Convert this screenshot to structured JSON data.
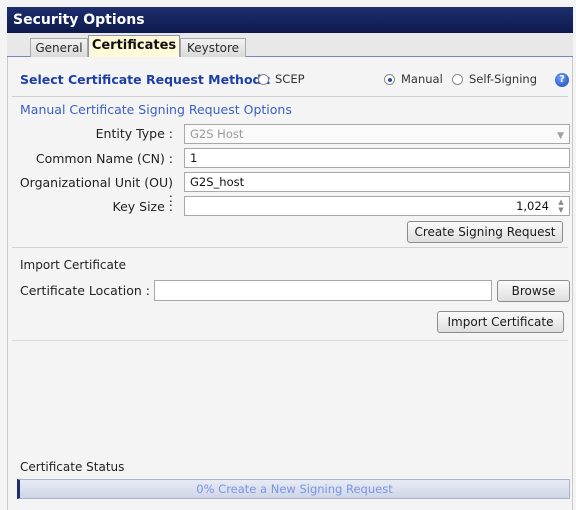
{
  "window": {
    "title": "Security Options"
  },
  "tabs": [
    {
      "label": "General",
      "active": false
    },
    {
      "label": "Certificates",
      "active": true
    },
    {
      "label": "Keystore",
      "active": false
    }
  ],
  "method": {
    "label": "Select Certificate Request Method :",
    "options": [
      {
        "label": "SCEP",
        "selected": false
      },
      {
        "label": "Manual",
        "selected": true
      },
      {
        "label": "Self-Signing",
        "selected": false
      }
    ]
  },
  "manual_csr": {
    "section_title": "Manual Certificate Signing Request Options",
    "entity_type": {
      "label": "Entity Type :",
      "value": "G2S Host"
    },
    "common_name": {
      "label": "Common Name (CN) :",
      "value": "1"
    },
    "org_unit": {
      "label": "Organizational Unit (OU) :",
      "value": "G2S_host"
    },
    "key_size": {
      "label": "Key Size :",
      "value": "1,024"
    },
    "create_button": "Create Signing Request"
  },
  "import": {
    "section_title": "Import Certificate",
    "location_label": "Certificate Location :",
    "location_value": "",
    "browse_button": "Browse",
    "import_button": "Import Certificate"
  },
  "status": {
    "title": "Certificate Status",
    "progress_text": "0%   Create a New Signing Request",
    "progress_percent": 0
  },
  "colors": {
    "title_bar": "#0e1a4c",
    "accent_text": "#1f3fa8",
    "progress_text": "#7a94e6"
  }
}
